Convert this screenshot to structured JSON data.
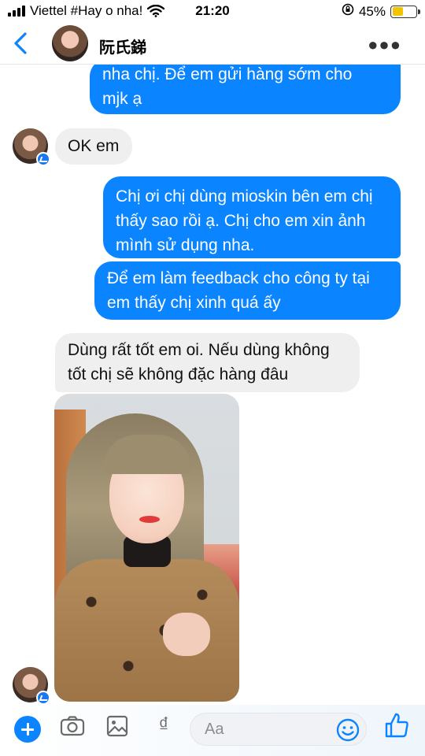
{
  "status_bar": {
    "carrier": "Viettel #Hay o nha!",
    "time": "21:20",
    "battery": "45%",
    "battery_level": 0.45
  },
  "header": {
    "contact_name": "阮氏銻"
  },
  "messages": [
    {
      "side": "outgoing",
      "text_lines": [
        "nha chị. Để em gửi hàng sớm cho",
        "mjk ạ"
      ]
    },
    {
      "side": "incoming",
      "text_lines": [
        "OK em"
      ]
    },
    {
      "side": "outgoing",
      "text_lines": [
        "Chị ơi chị dùng mioskin bên em chị",
        "thấy sao rồi ạ. Chị cho em xin ảnh",
        "mình sử dụng nha."
      ]
    },
    {
      "side": "outgoing",
      "text_lines": [
        "Để em làm feedback cho công ty tại",
        "em thấy chị xinh quá ấy"
      ]
    },
    {
      "side": "incoming",
      "text_lines": [
        "Dùng rất tốt em oi. Nếu dùng không",
        "tốt chị sẽ không đặc hàng đâu"
      ]
    }
  ],
  "composer": {
    "placeholder": "Aa",
    "currency_symbol": "₫"
  },
  "colors": {
    "outgoing_bubble": "#0a84ff",
    "incoming_bubble": "#efefef",
    "accent": "#0a84ff"
  },
  "icons": [
    "back-chevron-icon",
    "more-icon",
    "plus-icon",
    "camera-icon",
    "gallery-icon",
    "dong-icon",
    "emoji-icon",
    "like-icon",
    "messenger-badge-icon"
  ]
}
